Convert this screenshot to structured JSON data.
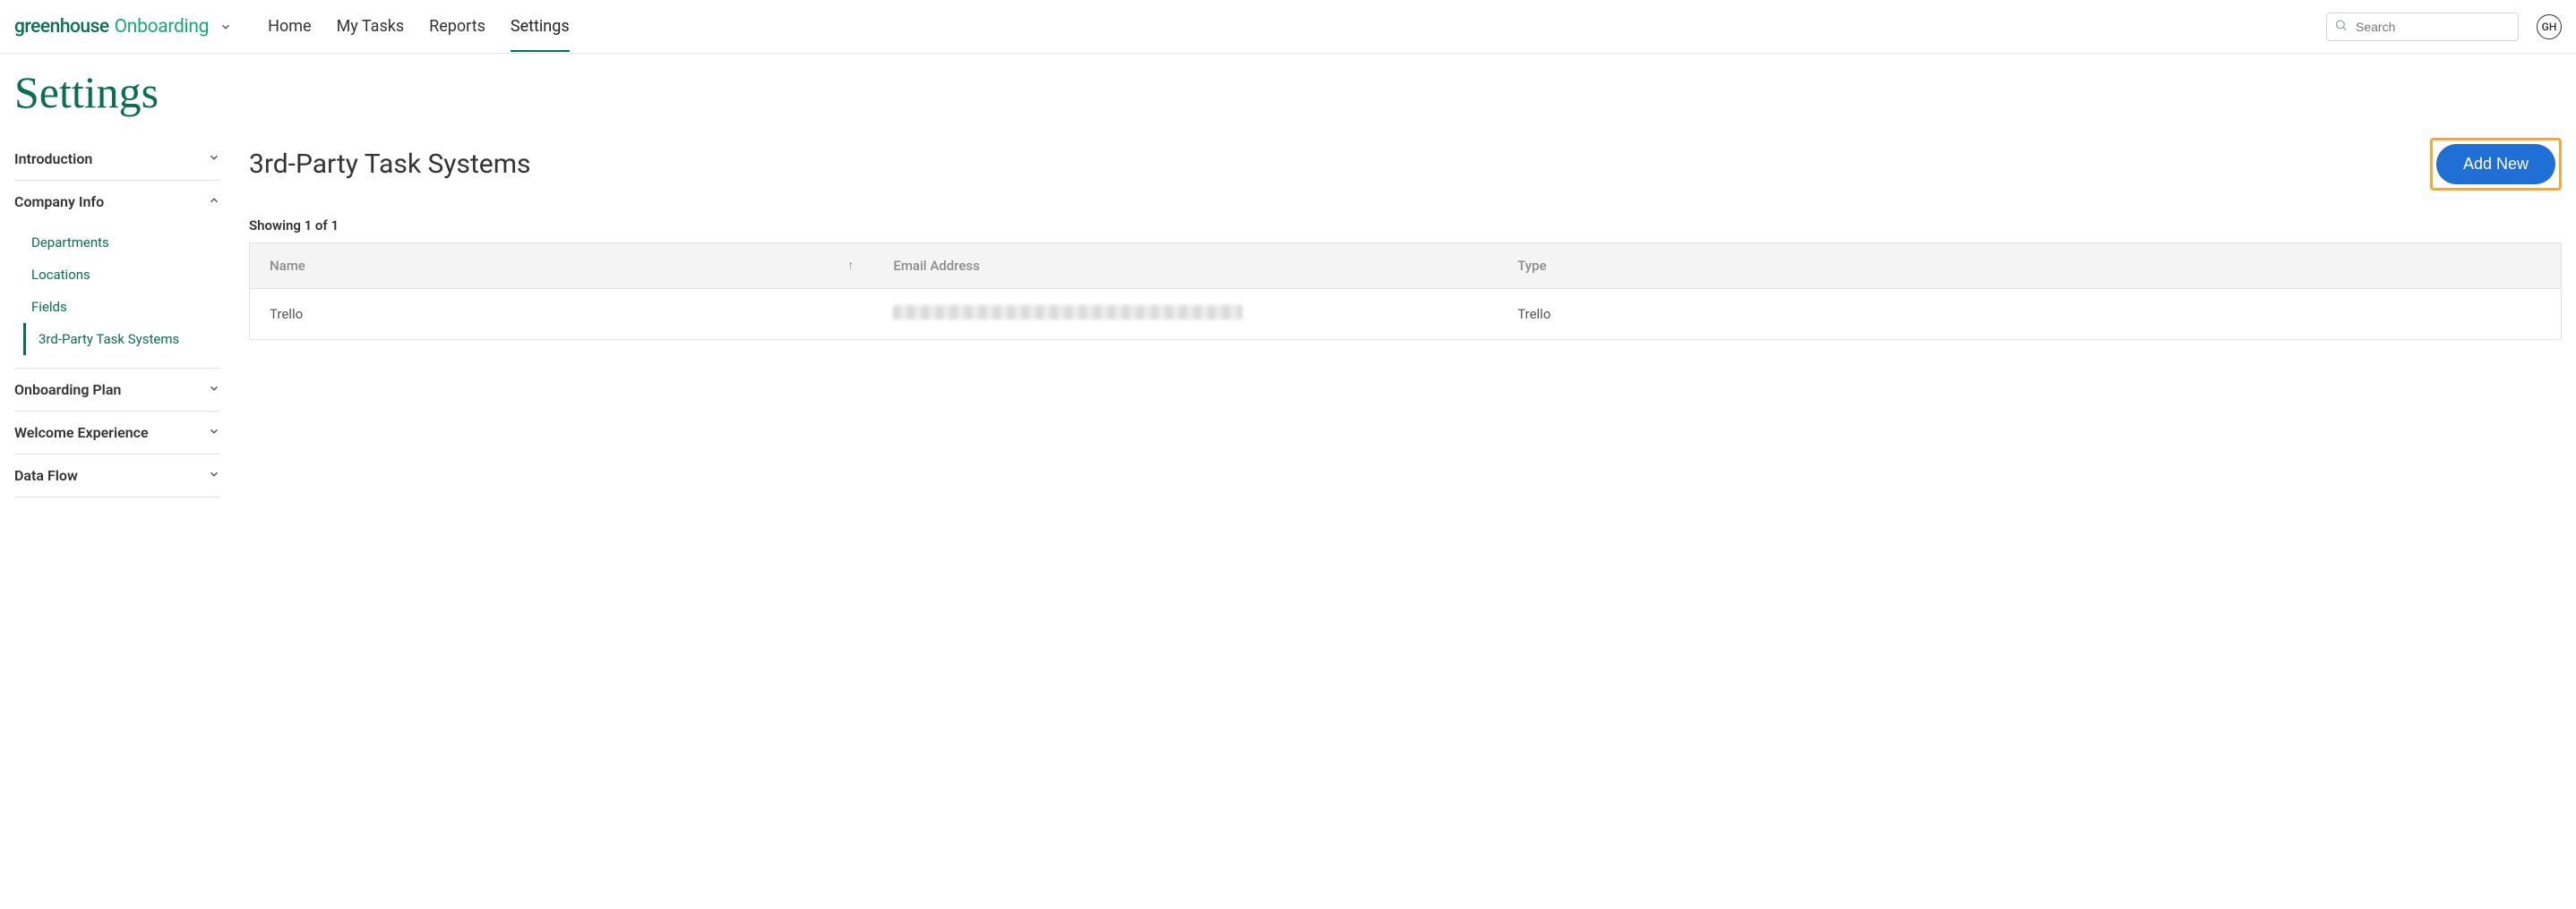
{
  "header": {
    "logo_primary": "greenhouse",
    "logo_secondary": "Onboarding",
    "nav": [
      "Home",
      "My Tasks",
      "Reports",
      "Settings"
    ],
    "nav_active_index": 3,
    "search_placeholder": "Search",
    "avatar_initials": "GH"
  },
  "page_title": "Settings",
  "sidebar": {
    "sections": [
      {
        "label": "Introduction",
        "expanded": false
      },
      {
        "label": "Company Info",
        "expanded": true,
        "items": [
          "Departments",
          "Locations",
          "Fields",
          "3rd-Party Task Systems"
        ],
        "active_item_index": 3
      },
      {
        "label": "Onboarding Plan",
        "expanded": false
      },
      {
        "label": "Welcome Experience",
        "expanded": false
      },
      {
        "label": "Data Flow",
        "expanded": false
      }
    ]
  },
  "main": {
    "title": "3rd-Party Task Systems",
    "add_button_label": "Add New",
    "showing_text": "Showing 1 of 1",
    "columns": [
      "Name",
      "Email Address",
      "Type"
    ],
    "sort_column_index": 0,
    "rows": [
      {
        "name": "Trello",
        "email": "",
        "type": "Trello"
      }
    ]
  }
}
